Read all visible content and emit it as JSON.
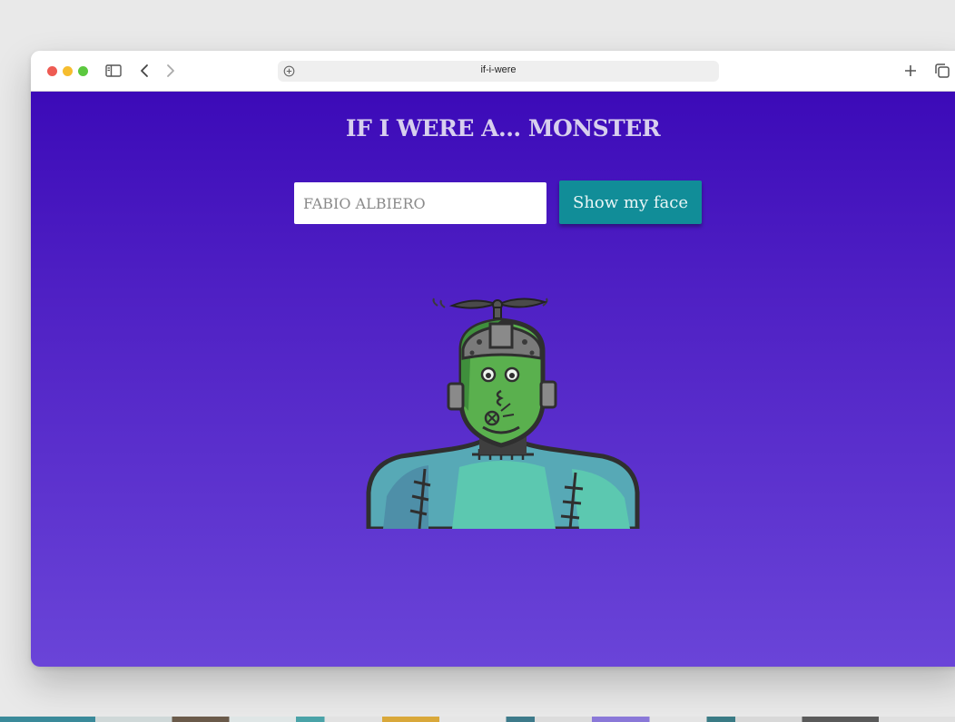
{
  "browser": {
    "url": "if-i-were",
    "icons": [
      "sidebar-icon",
      "back-icon",
      "forward-icon",
      "site-settings-icon",
      "new-tab-icon",
      "tabs-overview-icon"
    ]
  },
  "page": {
    "title": "IF I WERE A... MONSTER",
    "name_input": {
      "value": "FABIO ALBIERO",
      "placeholder": ""
    },
    "show_button_label": "Show my face",
    "image": "monster-avatar"
  },
  "colors": {
    "gradient_top": "#3c0ab8",
    "gradient_bottom": "#6a44d8",
    "button": "#118d98",
    "title_text": "#d7cfee"
  }
}
